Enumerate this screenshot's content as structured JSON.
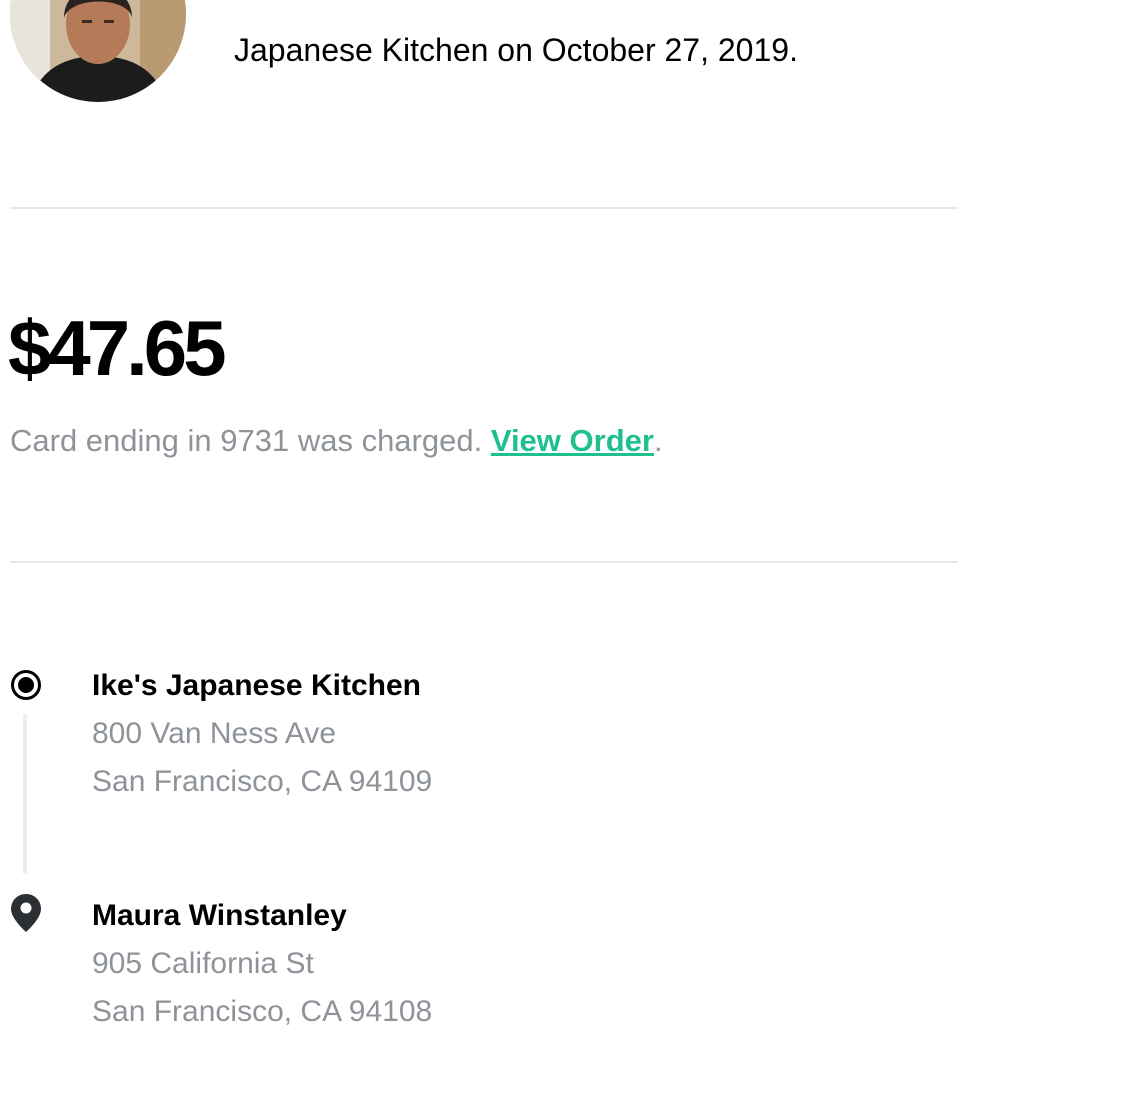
{
  "receipt": {
    "dispatch_line": "Japanese Kitchen on October 27, 2019.",
    "amount": "$47.65",
    "charge_text": "Card ending in 9731 was charged. ",
    "view_order_label": "View Order",
    "charge_suffix": "."
  },
  "route": {
    "pickup": {
      "name": "Ike's Japanese Kitchen",
      "address_line1": "800 Van Ness Ave",
      "address_line2": "San Francisco, CA 94109",
      "icon": "radio-dot-icon"
    },
    "dropoff": {
      "name": "Maura Winstanley",
      "address_line1": "905 California St",
      "address_line2": "San Francisco, CA 94108",
      "icon": "map-pin-icon"
    }
  },
  "colors": {
    "link": "#1fbf8f",
    "muted_text": "#8e9399",
    "divider": "#e6e8ec"
  }
}
